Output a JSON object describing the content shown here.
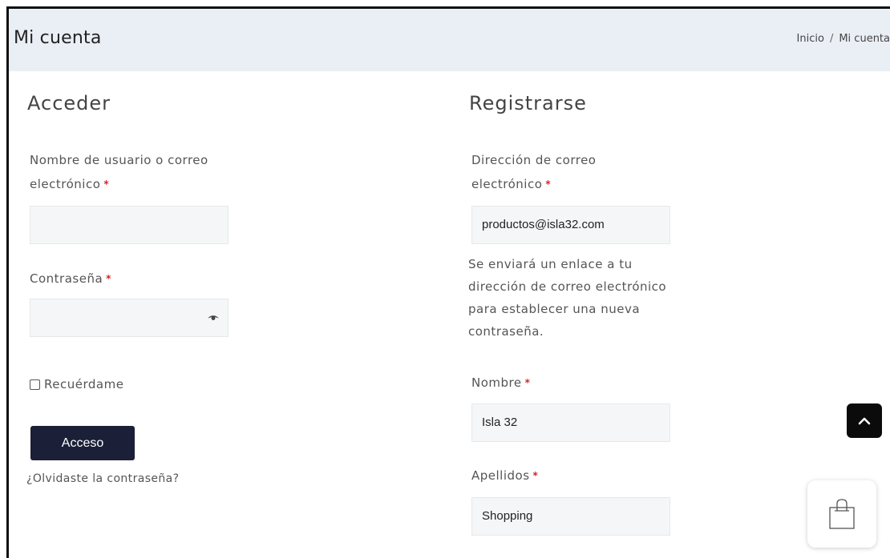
{
  "header": {
    "title": "Mi cuenta",
    "breadcrumb": {
      "home": "Inicio",
      "separator": "/",
      "current": "Mi cuenta"
    }
  },
  "login": {
    "heading": "Acceder",
    "username_label_line1": "Nombre de usuario o correo",
    "username_label_line2": "electrónico",
    "username_value": "",
    "password_label": "Contraseña",
    "password_value": "",
    "remember_label": "Recuérdame",
    "submit_label": "Acceso",
    "forgot_link": "¿Olvidaste la contraseña?"
  },
  "register": {
    "heading": "Registrarse",
    "email_label_line1": "Dirección de correo",
    "email_label_line2": "electrónico",
    "email_value": "productos@isla32.com",
    "note_line1": "Se enviará un enlace a tu",
    "note_line2": "dirección de correo electrónico",
    "note_line3": "para establecer una nueva",
    "note_line4": "contraseña.",
    "first_name_label": "Nombre",
    "first_name_value": "Isla 32",
    "last_name_label": "Apellidos",
    "last_name_value": "Shopping"
  },
  "required_marker": "*",
  "icons": {
    "password_toggle": "eye-icon",
    "scroll_top": "chevron-up-icon",
    "cart": "shopping-bag-icon"
  },
  "colors": {
    "header_bg": "#eaeff5",
    "button_bg": "#1b2038",
    "required": "#d9202a",
    "field_bg": "#f5f6f7"
  }
}
